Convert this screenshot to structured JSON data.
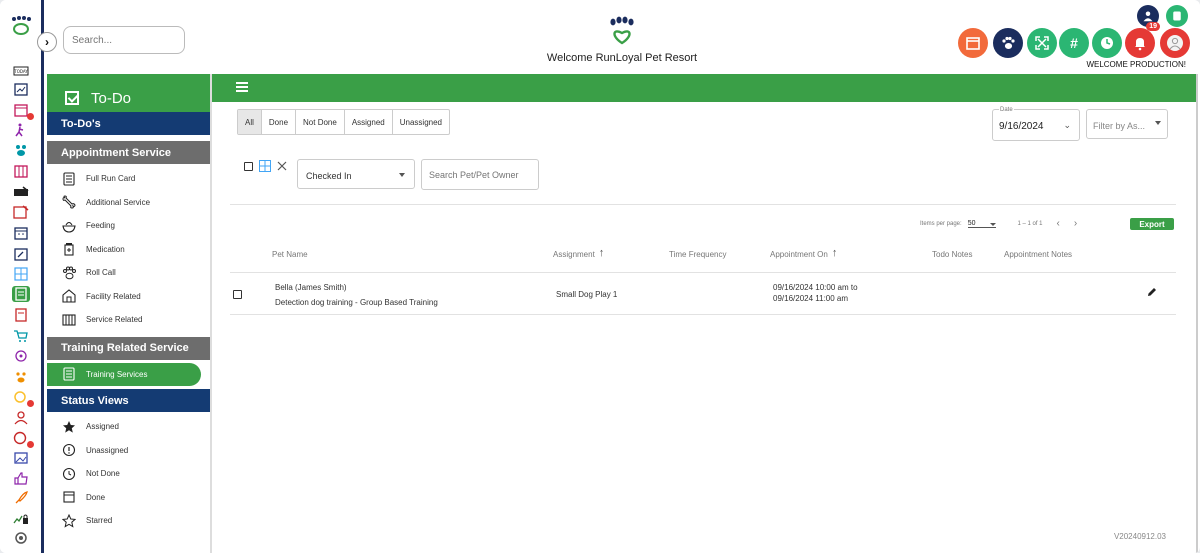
{
  "header": {
    "search_placeholder": "Search...",
    "welcome": "Welcome RunLoyal Pet Resort",
    "welcome_production": "WELCOME PRODUCTION!",
    "notification_count": "19",
    "buttons": [
      {
        "name": "calendar-icon",
        "color": "#f26a3b"
      },
      {
        "name": "paw-icon",
        "color": "#1b2d5e"
      },
      {
        "name": "expand-icon",
        "color": "#2bb673"
      },
      {
        "name": "hash-icon",
        "color": "#2bb673"
      },
      {
        "name": "clock-icon",
        "color": "#2bb673"
      },
      {
        "name": "bell-icon",
        "color": "#e53935"
      }
    ]
  },
  "menu": {
    "title": "To-Do",
    "sections": {
      "todos": "To-Do's",
      "appointment": "Appointment Service",
      "training": "Training Related Service",
      "status": "Status Views"
    },
    "appointment_items": [
      "Full Run Card",
      "Additional Service",
      "Feeding",
      "Medication",
      "Roll Call",
      "Facility Related",
      "Service Related"
    ],
    "training_items": [
      "Training Services"
    ],
    "status_items": [
      "Assigned",
      "Unassigned",
      "Not Done",
      "Done",
      "Starred"
    ]
  },
  "filters": {
    "tabs": [
      "All",
      "Done",
      "Not Done",
      "Assigned",
      "Unassigned"
    ],
    "active_tab": "All",
    "date_label": "Date",
    "date_value": "9/16/2024",
    "filter_placeholder": "Filter by As...",
    "status_value": "Checked In",
    "pet_search_placeholder": "Search Pet/Pet Owner"
  },
  "table": {
    "items_per_page_label": "Items per page:",
    "items_per_page": "50",
    "range": "1 – 1 of 1",
    "export_label": "Export",
    "columns": {
      "pet_name": "Pet Name",
      "assignment": "Assignment",
      "time_frequency": "Time Frequency",
      "appointment_on": "Appointment On",
      "todo_notes": "Todo Notes",
      "appointment_notes": "Appointment Notes"
    },
    "rows": [
      {
        "pet": "Bella (James Smith)",
        "service": "Detection dog training - Group Based Training",
        "assignment": "Small Dog Play 1",
        "appointment_start": "09/16/2024 10:00 am to",
        "appointment_end": "09/16/2024 11:00 am"
      }
    ]
  },
  "version": "V20240912.03"
}
